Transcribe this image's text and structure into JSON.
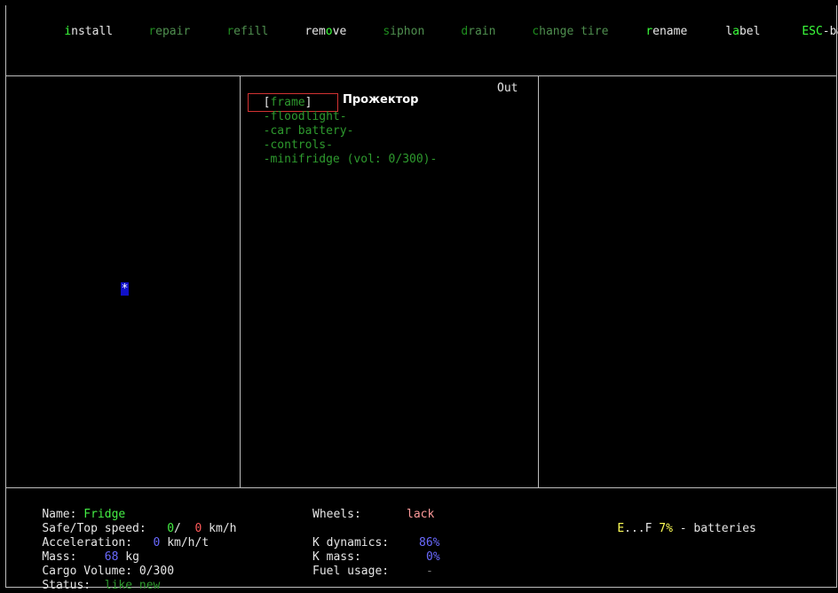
{
  "menu": [
    {
      "key": "i",
      "rest": "nstall",
      "active": true
    },
    {
      "key": "r",
      "rest": "epair",
      "active": false
    },
    {
      "key": "r",
      "rest": "efill",
      "active": false
    },
    {
      "pre": "rem",
      "key": "o",
      "rest": "ve",
      "active": true
    },
    {
      "key": "s",
      "rest": "iphon",
      "active": false
    },
    {
      "key": "d",
      "rest": "rain",
      "active": false
    },
    {
      "key": "c",
      "rest": "hange tire",
      "active": false
    },
    {
      "key": "r",
      "rest": "ename",
      "active": true
    },
    {
      "pre": "l",
      "key": "a",
      "rest": "bel",
      "active": true
    },
    {
      "key": "ESC",
      "rest": "-back",
      "active": true
    }
  ],
  "parts_panel": {
    "frame_label": "frame",
    "out_label": "Out",
    "items": [
      {
        "text": "floodlight",
        "selected": true
      },
      {
        "text": "car battery",
        "selected": false
      },
      {
        "text": "controls",
        "selected": false
      },
      {
        "text": "minifridge (vol: 0/300)",
        "selected": false
      }
    ],
    "selected_description": "Прожектор"
  },
  "map_cursor": "*",
  "stats": {
    "name_label": "Name:",
    "name_value": "Fridge",
    "safe_top_label": "Safe/Top speed:",
    "safe_speed": "0",
    "top_speed": "0",
    "speed_unit": "km/h",
    "accel_label": "Acceleration:",
    "accel_value": "0",
    "accel_unit": "km/h/t",
    "mass_label": "Mass:",
    "mass_value": "68",
    "mass_unit": "kg",
    "cargo_label": "Cargo Volume:",
    "cargo_value": "0/300",
    "status_label": "Status:",
    "status_value": "like new",
    "wheels_label": "Wheels:",
    "wheels_value": "lack",
    "kdyn_label": "K dynamics:",
    "kdyn_value": "86%",
    "kmass_label": "K mass:",
    "kmass_value": "0%",
    "fuel_label": "Fuel usage:",
    "fuel_value": "-",
    "fuel_gauge_e": "E",
    "fuel_gauge_mid": "...F",
    "fuel_pct": "7%",
    "fuel_type": "- batteries"
  },
  "colors": {
    "hotkey": "#3bff3b",
    "border": "#bdbdbd",
    "selection": "#d23232"
  }
}
